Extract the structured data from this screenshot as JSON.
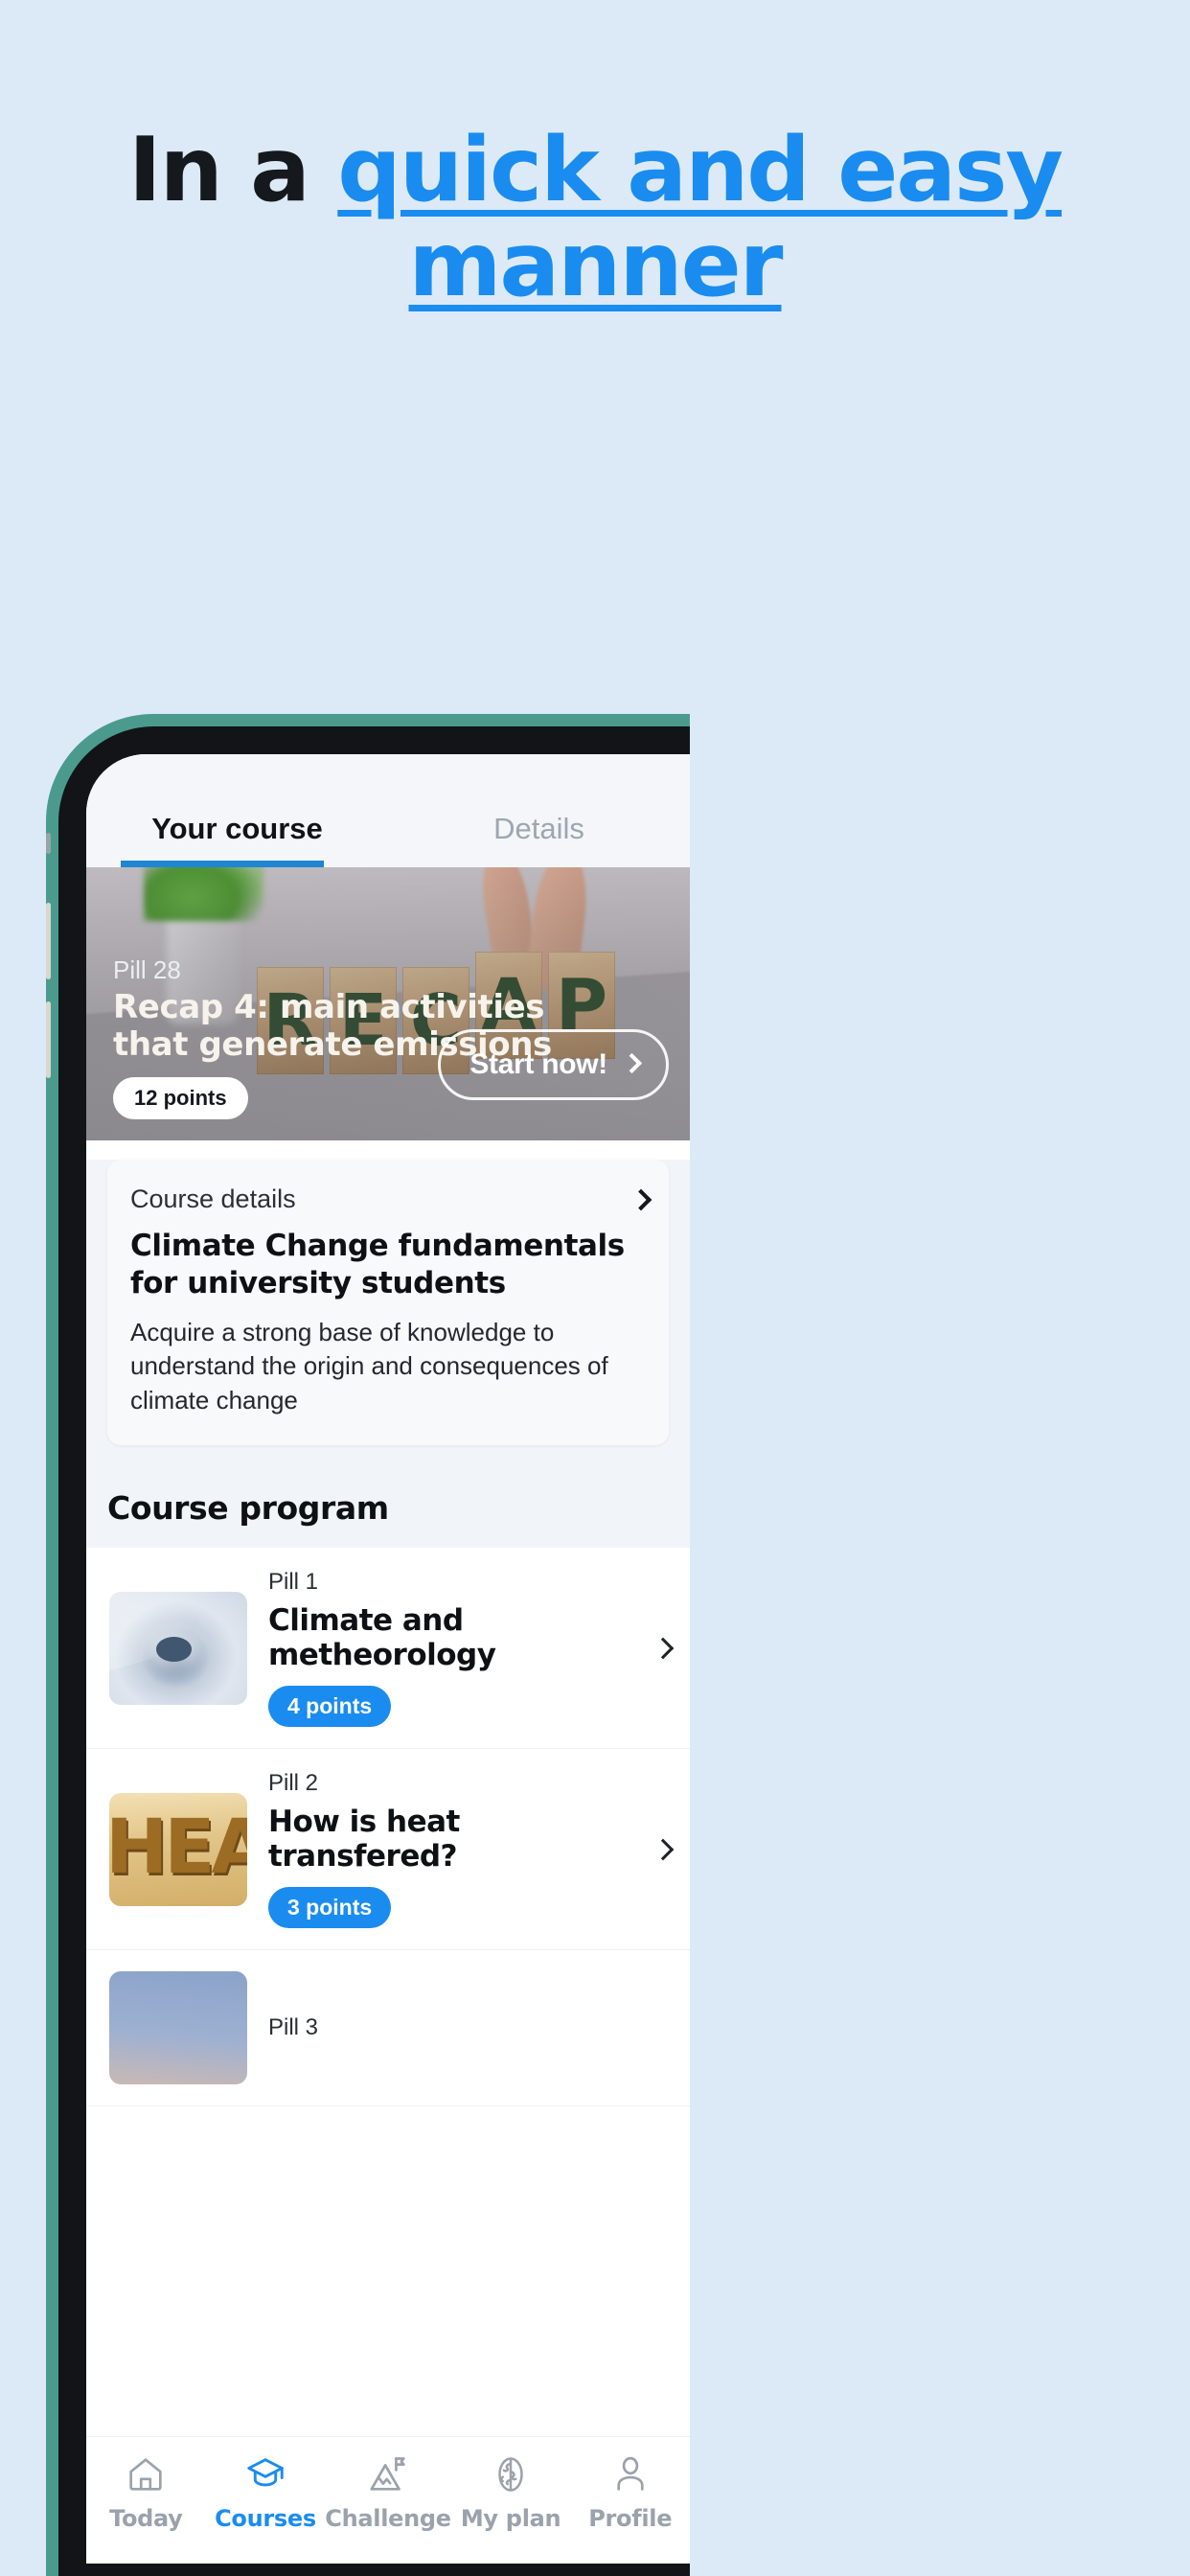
{
  "promo": {
    "headline_lead": "In a ",
    "headline_accent": "quick and easy manner"
  },
  "colors": {
    "page_background": "#dceaf7",
    "accent_blue": "#1a8cf0",
    "headline_dark": "#15181c",
    "phone_frame_teal": "#4a9b8e",
    "phone_bezel": "#121418",
    "tab_indicator": "#1f86d4",
    "card_background": "#f8f9fa",
    "screen_background": "#f1f4f8"
  },
  "app": {
    "tabs": [
      {
        "label": "Your course",
        "active": true
      },
      {
        "label": "Details",
        "active": false
      }
    ],
    "hero": {
      "pill_label": "Pill 28",
      "title": "Recap 4: main activities that generate emissions",
      "points_badge": "12 points",
      "cta_label": "Start now!",
      "cta_icon": "chevron-right-icon",
      "image_blocks": [
        "R",
        "E",
        "C",
        "A",
        "P"
      ]
    },
    "course_details": {
      "section_label": "Course details",
      "chevron_icon": "chevron-right-icon",
      "title": "Climate Change fundamentals for university students",
      "description": "Acquire a strong base of knowledge to understand the origin and consequences of climate change"
    },
    "program": {
      "heading": "Course program",
      "items": [
        {
          "pill_no": "Pill 1",
          "name": "Climate and metheorology",
          "points": "4 points",
          "thumb": "hurricane",
          "chevron_icon": "chevron-right-icon"
        },
        {
          "pill_no": "Pill 2",
          "name": "How is heat transfered?",
          "points": "3 points",
          "thumb": "heat",
          "chevron_icon": "chevron-right-icon"
        },
        {
          "pill_no": "Pill 3",
          "name": "",
          "points": "",
          "thumb": "sky",
          "chevron_icon": "chevron-right-icon"
        }
      ]
    },
    "bottom_nav": [
      {
        "label": "Today",
        "icon": "home-icon",
        "active": false
      },
      {
        "label": "Courses",
        "icon": "graduation-cap-icon",
        "active": true
      },
      {
        "label": "Challenge",
        "icon": "mountain-flag-icon",
        "active": false
      },
      {
        "label": "My plan",
        "icon": "brain-icon",
        "active": false
      },
      {
        "label": "Profile",
        "icon": "person-icon",
        "active": false
      }
    ]
  }
}
